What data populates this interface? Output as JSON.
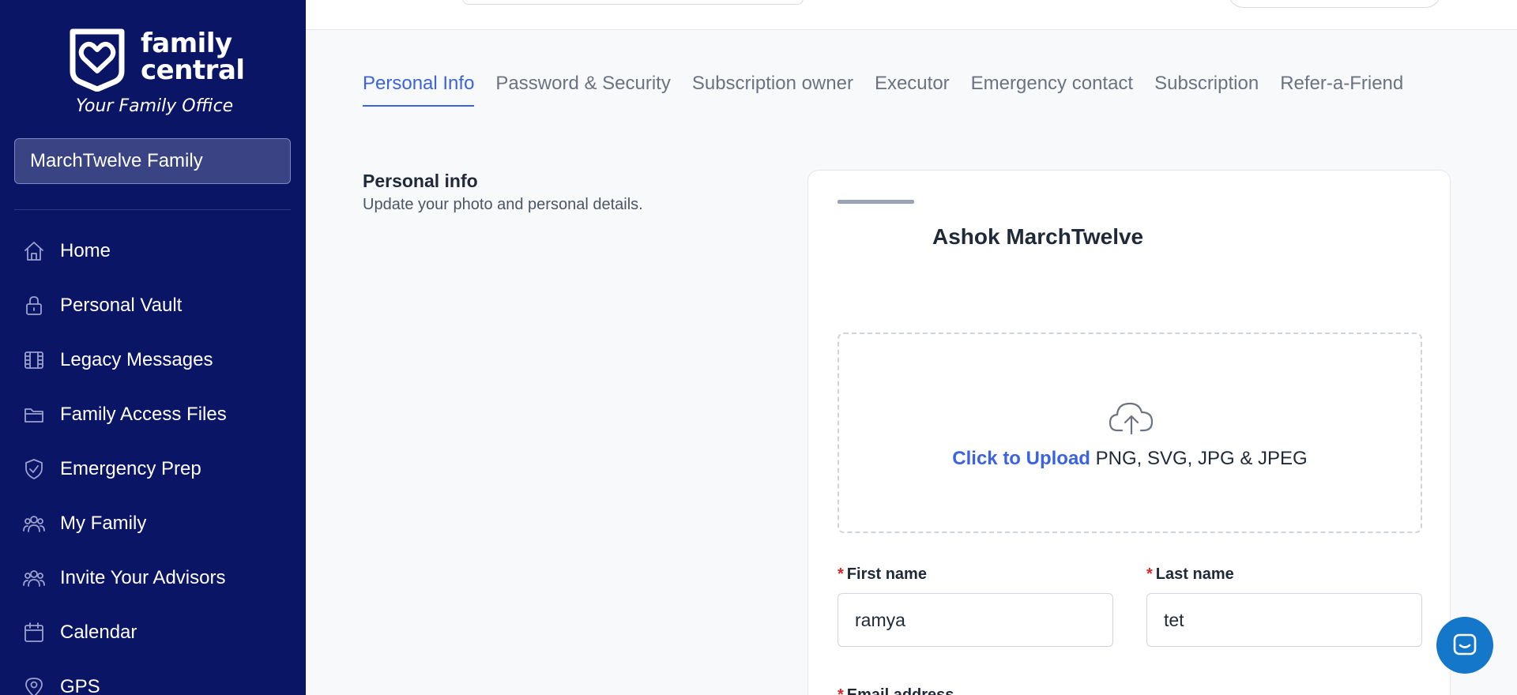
{
  "brand": {
    "name_line1": "family",
    "name_line2": "central",
    "tagline": "Your Family Office"
  },
  "family_selector": {
    "value": "MarchTwelve Family"
  },
  "nav": [
    {
      "label": "Home",
      "icon": "home-icon"
    },
    {
      "label": "Personal Vault",
      "icon": "lock-icon"
    },
    {
      "label": "Legacy Messages",
      "icon": "film-icon"
    },
    {
      "label": "Family Access Files",
      "icon": "folder-icon"
    },
    {
      "label": "Emergency Prep",
      "icon": "shield-check-icon"
    },
    {
      "label": "My Family",
      "icon": "users-icon"
    },
    {
      "label": "Invite Your Advisors",
      "icon": "users-icon"
    },
    {
      "label": "Calendar",
      "icon": "calendar-icon"
    },
    {
      "label": "GPS",
      "icon": "map-pin-icon"
    }
  ],
  "tabs": [
    {
      "label": "Personal Info",
      "active": true
    },
    {
      "label": "Password & Security",
      "active": false
    },
    {
      "label": "Subscription owner",
      "active": false
    },
    {
      "label": "Executor",
      "active": false
    },
    {
      "label": "Emergency contact",
      "active": false
    },
    {
      "label": "Subscription",
      "active": false
    },
    {
      "label": "Refer-a-Friend",
      "active": false
    }
  ],
  "section": {
    "title": "Personal info",
    "subtitle": "Update your photo and personal details."
  },
  "profile": {
    "name": "Ashok MarchTwelve",
    "upload_link": "Click to Upload",
    "upload_formats": "PNG, SVG, JPG & JPEG",
    "first_name_label": "First name",
    "first_name_value": "ramya",
    "last_name_label": "Last name",
    "last_name_value": "tet",
    "email_label": "Email address",
    "required_mark": "*"
  },
  "colors": {
    "sidebar_bg": "#0b1566",
    "accent": "#3b63e0",
    "required": "#dc2626",
    "chat_button": "#1477c9"
  }
}
